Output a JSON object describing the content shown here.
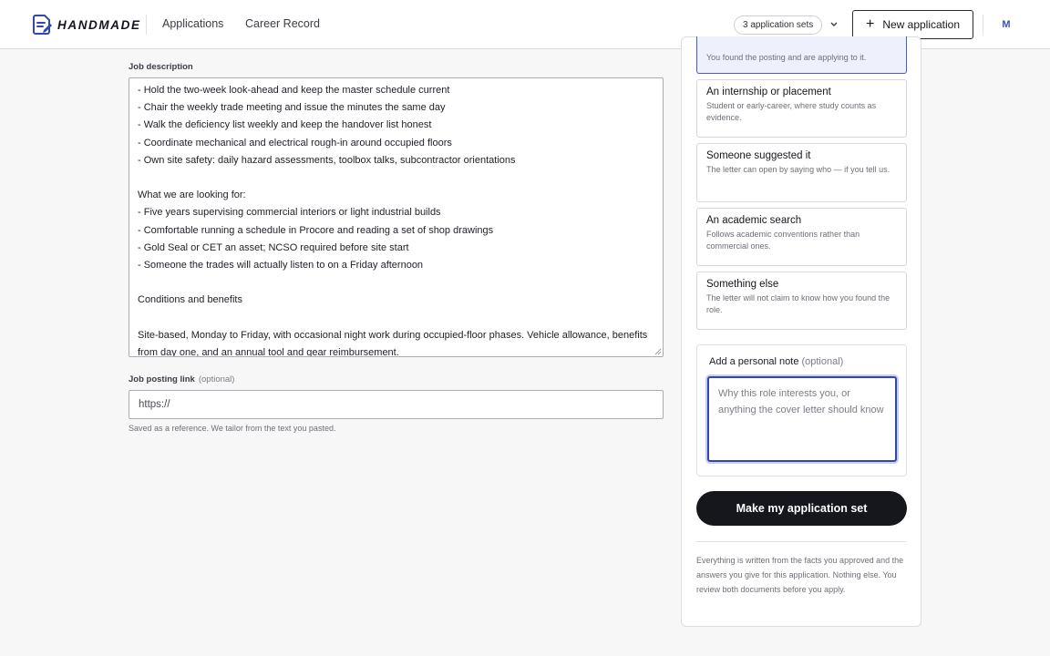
{
  "header": {
    "logo_text": "HANDMADE",
    "nav": [
      "Applications",
      "Career Record"
    ],
    "sets_pill": "3 application sets",
    "new_button": "New application",
    "avatar_initial": "M"
  },
  "job_description": {
    "label": "Job description",
    "text": "- Hold the two-week look-ahead and keep the master schedule current\n- Chair the weekly trade meeting and issue the minutes the same day\n- Walk the deficiency list weekly and keep the handover list honest\n- Coordinate mechanical and electrical rough-in around occupied floors\n- Own site safety: daily hazard assessments, toolbox talks, subcontractor orientations\n\nWhat we are looking for:\n- Five years supervising commercial interiors or light industrial builds\n- Comfortable running a schedule in Procore and reading a set of shop drawings\n- Gold Seal or CET an asset; NCSO required before site start\n- Someone the trades will actually listen to on a Friday afternoon\n\nConditions and benefits\n\nSite-based, Monday to Friday, with occasional night work during occupied-floor phases. Vehicle allowance, benefits from day one, and an annual tool and gear reimbursement."
  },
  "posting_link": {
    "label": "Job posting link",
    "optional": "(optional)",
    "placeholder": "https://",
    "help": "Saved as a reference. We tailor from the text you pasted."
  },
  "options": [
    {
      "title": "",
      "desc": "You found the posting and are applying to it.",
      "selected": true
    },
    {
      "title": "An internship or placement",
      "desc": "Student or early-career, where study counts as evidence.",
      "selected": false
    },
    {
      "title": "Someone suggested it",
      "desc": "The letter can open by saying who — if you tell us.",
      "selected": false
    },
    {
      "title": "An academic search",
      "desc": "Follows academic conventions rather than commercial ones.",
      "selected": false
    },
    {
      "title": "Something else",
      "desc": "The letter will not claim to know how you found the role.",
      "selected": false
    }
  ],
  "personal_note": {
    "label": "Add a personal note",
    "optional": "(optional)",
    "placeholder": "Why this role interests you, or anything the cover letter should know"
  },
  "make_button": "Make my application set",
  "footer_note": "Everything is written from the facts you approved and the answers you give for this application. Nothing else. You review both documents before you apply.",
  "colors": {
    "accent": "#3147b0",
    "selected_bg": "#eef0fb",
    "primary_button": "#15171d"
  }
}
